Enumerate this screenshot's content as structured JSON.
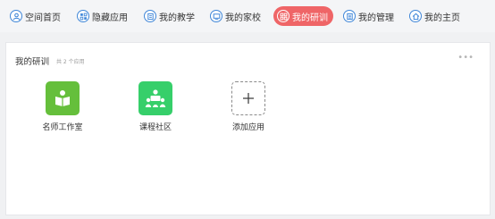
{
  "nav": {
    "items": [
      {
        "label": "空间首页",
        "icon": "person-icon"
      },
      {
        "label": "隐藏应用",
        "icon": "hidden-apps-icon"
      },
      {
        "label": "我的教学",
        "icon": "teaching-icon"
      },
      {
        "label": "我的家校",
        "icon": "monitor-icon"
      },
      {
        "label": "我的研训",
        "icon": "grid-icon",
        "active": true
      },
      {
        "label": "我的管理",
        "icon": "list-icon"
      },
      {
        "label": "我的主页",
        "icon": "home-icon"
      }
    ],
    "active_color": "#ef6567",
    "icon_color": "#3f86d8"
  },
  "panel": {
    "title": "我的研训",
    "count": "共 2 个应用",
    "more": "•••",
    "apps": [
      {
        "label": "名师工作室",
        "icon": "teacher-studio-icon",
        "color": "#65bf3b"
      },
      {
        "label": "课程社区",
        "icon": "course-community-icon",
        "color": "#36cf6a"
      },
      {
        "label": "添加应用",
        "icon": "plus-icon"
      }
    ]
  }
}
